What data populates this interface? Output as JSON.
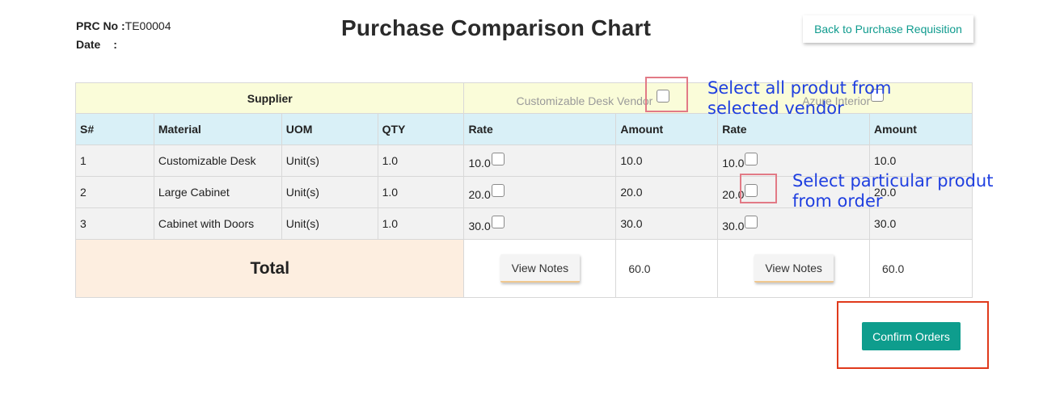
{
  "header": {
    "prc_label": "PRC No :",
    "prc_value": "TE00004",
    "date_label": "Date",
    "date_sep": ":",
    "title": "Purchase Comparison Chart",
    "back_button": "Back to Purchase Requisition"
  },
  "table": {
    "supplier_label": "Supplier",
    "vendors": [
      "Customizable Desk Vendor",
      "Azure Interior"
    ],
    "columns": [
      "S#",
      "Material",
      "UOM",
      "QTY",
      "Rate",
      "Amount",
      "Rate",
      "Amount"
    ],
    "rows": [
      {
        "sno": "1",
        "material": "Customizable Desk",
        "uom": "Unit(s)",
        "qty": "1.0",
        "rate1": "10.0",
        "amount1": "10.0",
        "rate2": "10.0",
        "amount2": "10.0"
      },
      {
        "sno": "2",
        "material": "Large Cabinet",
        "uom": "Unit(s)",
        "qty": "1.0",
        "rate1": "20.0",
        "amount1": "20.0",
        "rate2": "20.0",
        "amount2": "20.0"
      },
      {
        "sno": "3",
        "material": "Cabinet with Doors",
        "uom": "Unit(s)",
        "qty": "1.0",
        "rate1": "30.0",
        "amount1": "30.0",
        "rate2": "30.0",
        "amount2": "30.0"
      }
    ],
    "total_label": "Total",
    "view_notes": "View Notes",
    "total1": "60.0",
    "total2": "60.0"
  },
  "annotations": {
    "vendor_note_line1": "Select all produt from",
    "vendor_note_line2": "selected vendor",
    "row_note_line1": "Select particular produt",
    "row_note_line2": "from order"
  },
  "confirm_button": "Confirm Orders",
  "colors": {
    "accent": "#0e9d8d",
    "annotation_text": "#1f3fe0",
    "highlight_box": "#e27a86",
    "confirm_highlight": "#e03a1c"
  }
}
